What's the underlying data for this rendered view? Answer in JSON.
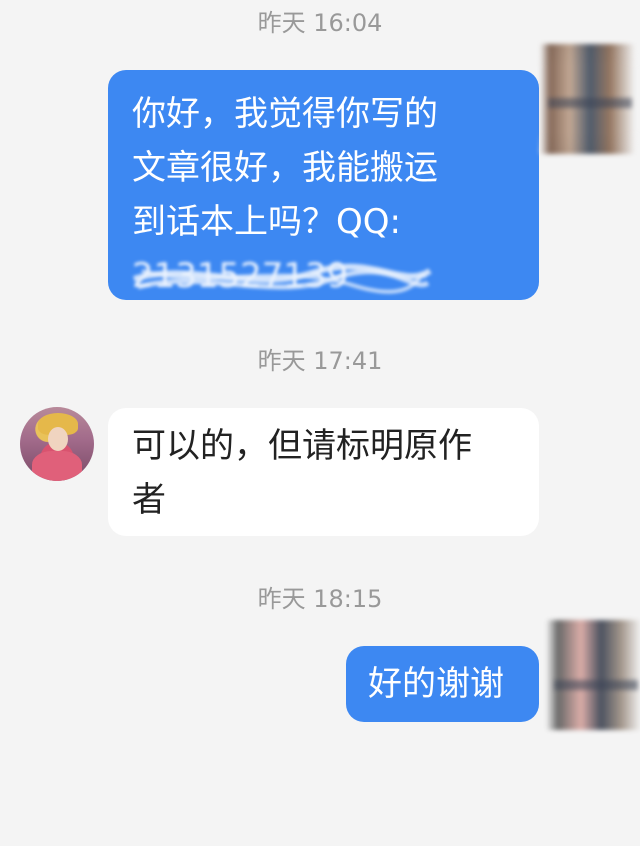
{
  "messages": [
    {
      "timestamp": "昨天 16:04",
      "direction": "sent",
      "lines": [
        "你好，我觉得你写的",
        "文章很好，我能搬运",
        "到话本上吗？QQ:"
      ],
      "obscured_number": "2131527139"
    },
    {
      "timestamp": "昨天 17:41",
      "direction": "received",
      "lines": [
        "可以的，但请标明原作",
        "者"
      ]
    },
    {
      "timestamp": "昨天 18:15",
      "direction": "sent",
      "lines": [
        "好的谢谢"
      ]
    }
  ],
  "colors": {
    "background": "#f4f4f4",
    "sent_bubble": "#3d88f2",
    "received_bubble": "#ffffff",
    "timestamp_text": "#999999"
  },
  "icons": {
    "friend_avatar": "anime-character-avatar-icon",
    "self_avatar": "blurred-avatar-icon"
  }
}
